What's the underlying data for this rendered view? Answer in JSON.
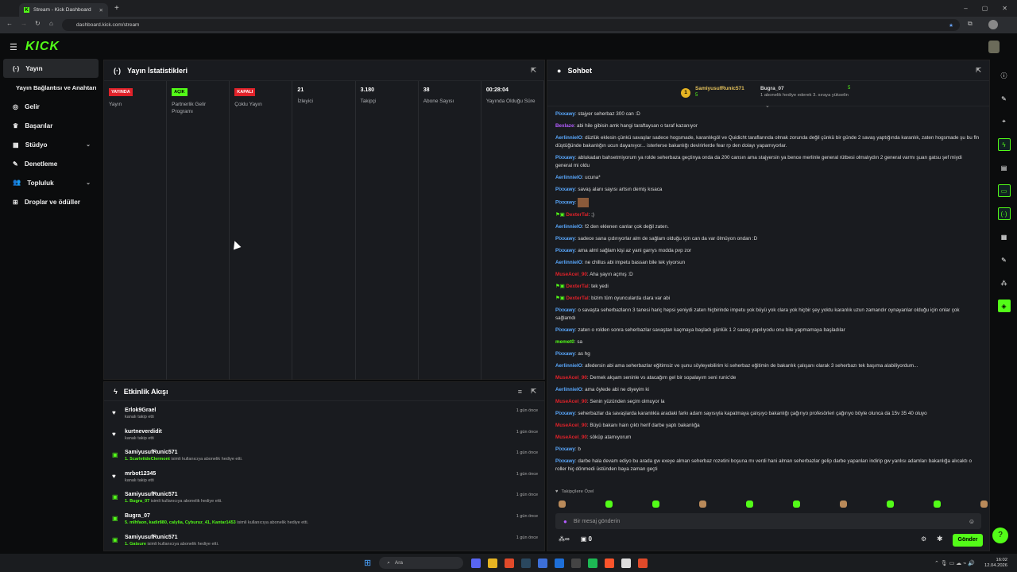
{
  "browser": {
    "tab_title": "Stream - Kick Dashboard",
    "url": "dashboard.kick.com/stream"
  },
  "brand": {
    "logo": "KICK",
    "accent": "#53fc18"
  },
  "sidebar": {
    "items": [
      {
        "label": "Yayın",
        "icon": "broadcast-icon"
      },
      {
        "label": "Yayın Bağlantısı ve Anahtarı",
        "icon": ""
      },
      {
        "label": "Gelir",
        "icon": "globe-icon"
      },
      {
        "label": "Başarılar",
        "icon": "trophy-icon"
      },
      {
        "label": "Stüdyo",
        "icon": "layout-icon"
      },
      {
        "label": "Denetleme",
        "icon": "wrench-icon"
      },
      {
        "label": "Topluluk",
        "icon": "people-icon"
      },
      {
        "label": "Droplar ve ödüller",
        "icon": "gift-icon"
      }
    ]
  },
  "stats_panel": {
    "title": "Yayın İstatistikleri",
    "items": [
      {
        "badge": "YAYINDA",
        "badge_color": "#e0222a",
        "label": "Yayın"
      },
      {
        "badge": "AÇIK",
        "badge_color": "#53fc18",
        "label": "Partnerlik Gelir Programı"
      },
      {
        "badge": "KAPALI",
        "badge_color": "#e0222a",
        "label": "Çoklu Yayın"
      },
      {
        "value": "21",
        "label": "İzleyici"
      },
      {
        "value": "3.180",
        "label": "Takipçi"
      },
      {
        "value": "38",
        "label": "Abone Sayısı"
      },
      {
        "value": "00:28:04",
        "label": "Yayında Olduğu Süre"
      }
    ]
  },
  "activity": {
    "title": "Etkinlik Akışı",
    "items": [
      {
        "icon": "heart-icon",
        "name": "Erlok9Grael",
        "desc": "kanalı takip etti",
        "time": "1 gün önce"
      },
      {
        "icon": "heart-icon",
        "name": "kurtneverdidit",
        "desc": "kanalı takip etti",
        "time": "1 gün önce"
      },
      {
        "icon": "gift-icon",
        "name": "SamiyusufRunic571",
        "hl": "1. ScarlettdeClermont",
        "desc": "isimli kullanıcıya abonelik hediye etti.",
        "time": "1 gün önce"
      },
      {
        "icon": "heart-icon",
        "name": "mrbot12345",
        "desc": "kanalı takip etti",
        "time": "1 gün önce"
      },
      {
        "icon": "gift-icon",
        "name": "SamiyusufRunic571",
        "hl": "1. Bugra_07",
        "desc": "isimli kullanıcıya abonelik hediye etti.",
        "time": "1 gün önce"
      },
      {
        "icon": "gift-icon",
        "name": "Bugra_07",
        "hl": "5. mlhfaon, kadir880, calylia, Cyburuz_41, Kantar1453",
        "desc": "isimli kullanıcıya abonelik hediye etti.",
        "time": "1 gün önce"
      },
      {
        "icon": "gift-icon",
        "name": "SamiyusufRunic571",
        "hl": "1. Gatsure",
        "desc": "isimli kullanıcıya abonelik hediye etti.",
        "time": "1 gün önce"
      }
    ]
  },
  "chat": {
    "title": "Sohbet",
    "leader": {
      "rank": "1",
      "name": "SamiyusufRunic571",
      "count": "5",
      "second": "Bugra_07",
      "second_count": "5",
      "note": "1 abonelik hediye ederek 3. sıraya yükselin"
    },
    "messages": [
      {
        "u": "Pixxawy",
        "c": "#5aa9ff",
        "t": "stajyer seherbaz 300 can :D"
      },
      {
        "u": "Bexlaze",
        "c": "#b35cff",
        "t": "abi hile gibisin amk hangi taraftaysan o taraf kazanıyor"
      },
      {
        "u": "AerlinnielO",
        "c": "#5aa9ff",
        "t": "düzlük eklesin çünkü savaşlar sadece hogsmade, karanlıkgöl ve Quidicht taraflarında olmak zorunda değil çünkü bir günde 2 savaş yaptığında karanlık, zaten hogsmade şu bu fln düştüğünde bakanlığın ucun dayanıyor... isterlerse bakanlığı devirirlerde fear rp den dolayı yapamıyorlar."
      },
      {
        "u": "Pixxawy",
        "c": "#5aa9ff",
        "t": "ablukadan bahsetmiyorum ya rolde seherbaza geçtinya onda da 200 cansın ama stajyersin ya bence merlinle general rütbesi olmalıydın 2 general varmı şuan gatsu şef miydi general mi oldu"
      },
      {
        "u": "AerlinnielO",
        "c": "#5aa9ff",
        "t": "ucuna*"
      },
      {
        "u": "Pixxawy",
        "c": "#5aa9ff",
        "t": "savaş alanı sayısı artsın demiş kısaca"
      },
      {
        "u": "Pixxawy",
        "c": "#5aa9ff",
        "t": ""
      },
      {
        "u": "DexterTal",
        "c": "#e0222a",
        "t": ";)"
      },
      {
        "u": "AerlinnielO",
        "c": "#5aa9ff",
        "t": "f2 den eklenen canlar çok değil zaten."
      },
      {
        "u": "Pixxawy",
        "c": "#5aa9ff",
        "t": "sadece sana çıdırıyorlar alm de sağlam olduğu için can da var ölmüyon ondan :D"
      },
      {
        "u": "Pixxawy",
        "c": "#5aa9ff",
        "t": "ama alml sağlam kişi az yani garrys modda pvp zor"
      },
      {
        "u": "AerlinnielO",
        "c": "#5aa9ff",
        "t": "ne chillus abi impetu bassan bile tek yiyorsun"
      },
      {
        "u": "MuseAcel_90",
        "c": "#e0222a",
        "t": "Aha yayın açmış :D"
      },
      {
        "u": "DexterTal",
        "c": "#e0222a",
        "t": "tek yedi"
      },
      {
        "u": "DexterTal",
        "c": "#e0222a",
        "t": "bizim tüm oyuncularda clara var abi"
      },
      {
        "u": "Pixxawy",
        "c": "#5aa9ff",
        "t": "o savaşta seherbazların 3 tanesi hariç hepsi yeniydi zaten hiçbirinde impetu yok büyü yok clara yok hiçbir şey yoktu karanlık uzun zamandır oynayanlar olduğu için onlar çok sağlamdı"
      },
      {
        "u": "Pixxawy",
        "c": "#5aa9ff",
        "t": "zaten o rolden sonra seherbazlar savaştan kaçmaya başladı günlük 1 2 savaş yapılıyodu onu bile yapmamaya başladılar"
      },
      {
        "u": "memet0",
        "c": "#53fc18",
        "t": "sa"
      },
      {
        "u": "Pixxawy",
        "c": "#5aa9ff",
        "t": "as hg"
      },
      {
        "u": "AerlinnielO",
        "c": "#5aa9ff",
        "t": "afedersin abi ama seherbazlar eğitimsiz ve şunu söyleyebilirim ki seherbaz eğitimin de bakanlık çalışanı olarak 3 seherbazı tek başıma alabiliyordum..."
      },
      {
        "u": "MuseAcel_90",
        "c": "#e0222a",
        "t": "Demek akşam seninle vs atacağım gel bir sopalayım seni runic'de"
      },
      {
        "u": "AerlinnielO",
        "c": "#5aa9ff",
        "t": "ama öylede abi ne diyeyim ki"
      },
      {
        "u": "MuseAcel_90",
        "c": "#e0222a",
        "t": "Senin yüzünden seçim olmuyor la"
      },
      {
        "u": "Pixxawy",
        "c": "#5aa9ff",
        "t": "seherbazlar da savaşlarda karanlıkla aradaki farkı adam sayısıyla kapatmaya çalışıyo bakanlığı çağırıyo profesörleri çağırıyo böyle olunca da 15v 35 40 oluyo"
      },
      {
        "u": "MuseAcel_90",
        "c": "#e0222a",
        "t": "Büyü bakanı hain çıktı herif darbe yaptı bakanlığa"
      },
      {
        "u": "MuseAcel_90",
        "c": "#e0222a",
        "t": "söküp atamıyorum"
      },
      {
        "u": "Pixxawy",
        "c": "#5aa9ff",
        "t": "b"
      },
      {
        "u": "Pixxawy",
        "c": "#5aa9ff",
        "t": "darbe hala devam ediyo bu arada gw exeye alman seherbaz rozetini boşuna mı verdi hani alman seherbazlar gelip darbe yapanları indirip gw yanlısı adamları bakanlığa alıcaktı o roller hiç dönmedi üstünden baya zaman geçti"
      }
    ],
    "emote_label": "Takipçilere Özel",
    "input_placeholder": "Bir mesaj gönderin",
    "footer_count": "0",
    "send": "Gönder"
  },
  "taskbar": {
    "search": "Ara",
    "time": "16:02",
    "date": "12.04.2026"
  }
}
